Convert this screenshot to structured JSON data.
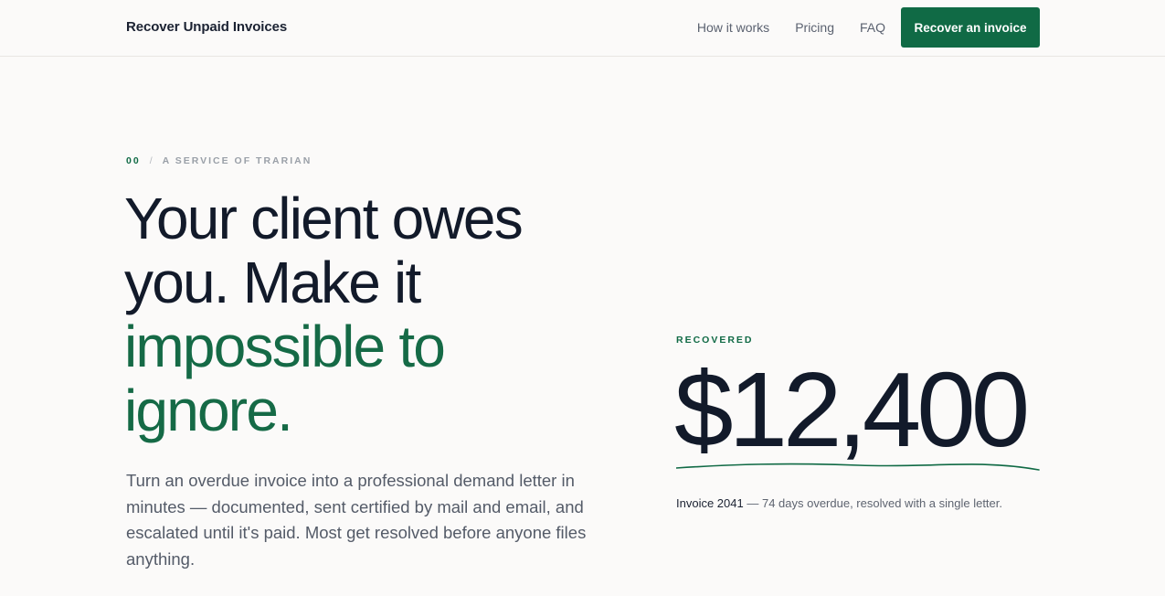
{
  "header": {
    "brand": "Recover Unpaid Invoices",
    "nav": [
      {
        "label": "How it works"
      },
      {
        "label": "Pricing"
      },
      {
        "label": "FAQ"
      }
    ],
    "cta_label": "Recover an invoice"
  },
  "hero": {
    "eyebrow_number": "00",
    "eyebrow_separator": "/",
    "eyebrow_text": "A SERVICE OF TRARIAN",
    "headline_line1": "Your client owes",
    "headline_line2": "you. Make it",
    "headline_accent_line1": "impossible to",
    "headline_accent_line2": "ignore.",
    "lede": "Turn an overdue invoice into a professional demand letter in minutes — documented, sent certified by mail and email, and escalated until it's paid. Most get resolved before anyone files anything."
  },
  "stat": {
    "label": "RECOVERED",
    "amount": "$12,400",
    "caption_ref": "Invoice 2041",
    "caption_rest": " — 74 days overdue, resolved with a single letter."
  },
  "colors": {
    "accent": "#106a45",
    "background": "#fbfaf9",
    "ink": "#121a2a"
  }
}
